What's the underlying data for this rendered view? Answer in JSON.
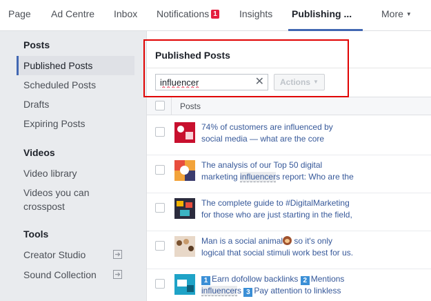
{
  "topnav": {
    "tabs": [
      {
        "label": "Page"
      },
      {
        "label": "Ad Centre"
      },
      {
        "label": "Inbox"
      },
      {
        "label": "Notifications",
        "badge": "1"
      },
      {
        "label": "Insights"
      },
      {
        "label": "Publishing ..."
      },
      {
        "label": "More"
      }
    ],
    "active_tab": "Publishing ..."
  },
  "sidebar": {
    "posts_title": "Posts",
    "posts_items": [
      "Published Posts",
      "Scheduled Posts",
      "Drafts",
      "Expiring Posts"
    ],
    "videos_title": "Videos",
    "videos_items": [
      "Video library",
      "Videos you can crosspost"
    ],
    "tools_title": "Tools",
    "tools_items": [
      "Creator Studio",
      "Sound Collection"
    ]
  },
  "main": {
    "title": "Published Posts",
    "search": {
      "value": "influencer",
      "clear_icon": "close-icon"
    },
    "actions_label": "Actions",
    "column_header": "Posts",
    "rows": [
      {
        "line1": "74% of customers are influenced by",
        "line2": "social media — what are the core"
      },
      {
        "line1": "The analysis of our Top 50 digital",
        "line2_pre": "marketing ",
        "line2_hl": "influencer",
        "line2_post": "s report: Who are the"
      },
      {
        "line1": "The complete guide to #DigitalMarketing",
        "line2": "for those who are just starting in the field,"
      },
      {
        "line1_pre": "Man is a social animal",
        "line1_post": " so it's only",
        "line2": "logical that social stimuli work best for us."
      },
      {
        "n1": "1",
        "seg1": "Earn dofollow backlinks ",
        "n2": "2",
        "seg2": "Mentions",
        "line2_hl": "influencer",
        "line2_mid": "s ",
        "n3": "3",
        "seg3": "Pay attention to linkless"
      }
    ]
  },
  "colors": {
    "accent": "#4267b2",
    "link": "#365899",
    "badge": "#e41e3f",
    "highlight_border": "#e00000"
  }
}
